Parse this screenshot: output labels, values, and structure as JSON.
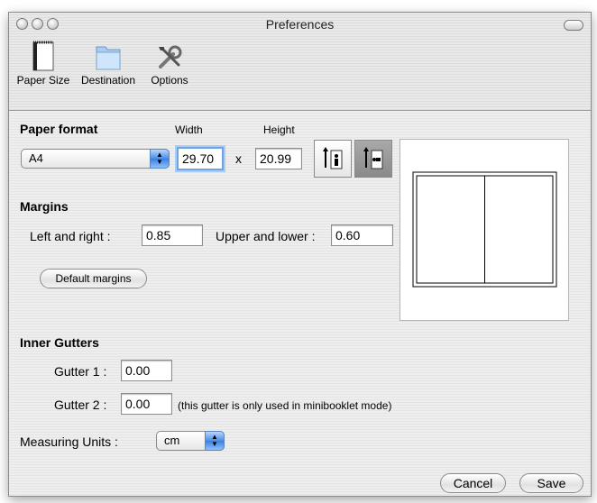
{
  "window": {
    "title": "Preferences"
  },
  "toolbar": {
    "items": [
      {
        "label": "Paper Size",
        "icon": "paper-size-icon"
      },
      {
        "label": "Destination",
        "icon": "folder-icon"
      },
      {
        "label": "Options",
        "icon": "tools-icon"
      }
    ]
  },
  "paper_format": {
    "heading": "Paper format",
    "width_label": "Width",
    "height_label": "Height",
    "format_value": "A4",
    "width_value": "29.70",
    "times": "x",
    "height_value": "20.99"
  },
  "margins": {
    "heading": "Margins",
    "left_right_label": "Left and right :",
    "left_right_value": "0.85",
    "upper_lower_label": "Upper and lower :",
    "upper_lower_value": "0.60",
    "default_button": "Default margins"
  },
  "gutters": {
    "heading": "Inner Gutters",
    "gutter1_label": "Gutter 1 :",
    "gutter1_value": "0.00",
    "gutter2_label": "Gutter 2 :",
    "gutter2_value": "0.00",
    "gutter2_note": "(this gutter is only used in minibooklet mode)"
  },
  "units": {
    "label": "Measuring Units :",
    "value": "cm"
  },
  "buttons": {
    "cancel": "Cancel",
    "save": "Save"
  }
}
